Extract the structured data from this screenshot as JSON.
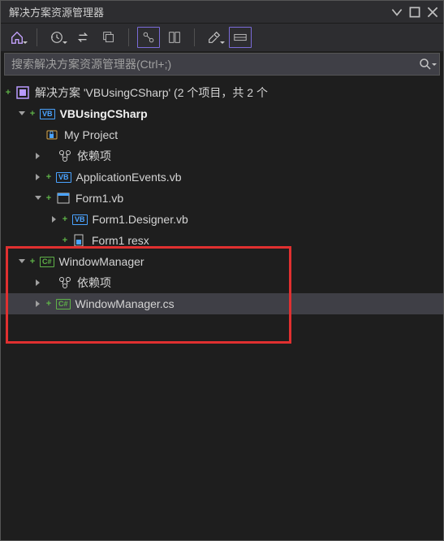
{
  "title": "解决方案资源管理器",
  "search_placeholder": "搜索解决方案资源管理器(Ctrl+;)",
  "solution": {
    "label": "解决方案 'VBUsingCSharp' (2 个项目，共 2 个"
  },
  "proj1": {
    "name": "VBUsingCSharp",
    "myproject": "My Project",
    "deps": "依赖项",
    "appevents": "ApplicationEvents.vb",
    "form1": "Form1.vb",
    "form1_designer": "Form1.Designer.vb",
    "form1_resx": "Form1 resx"
  },
  "proj2": {
    "name": "WindowManager",
    "deps": "依赖项",
    "file": "WindowManager.cs"
  },
  "badge_vb": "VB",
  "badge_cs": "C#"
}
